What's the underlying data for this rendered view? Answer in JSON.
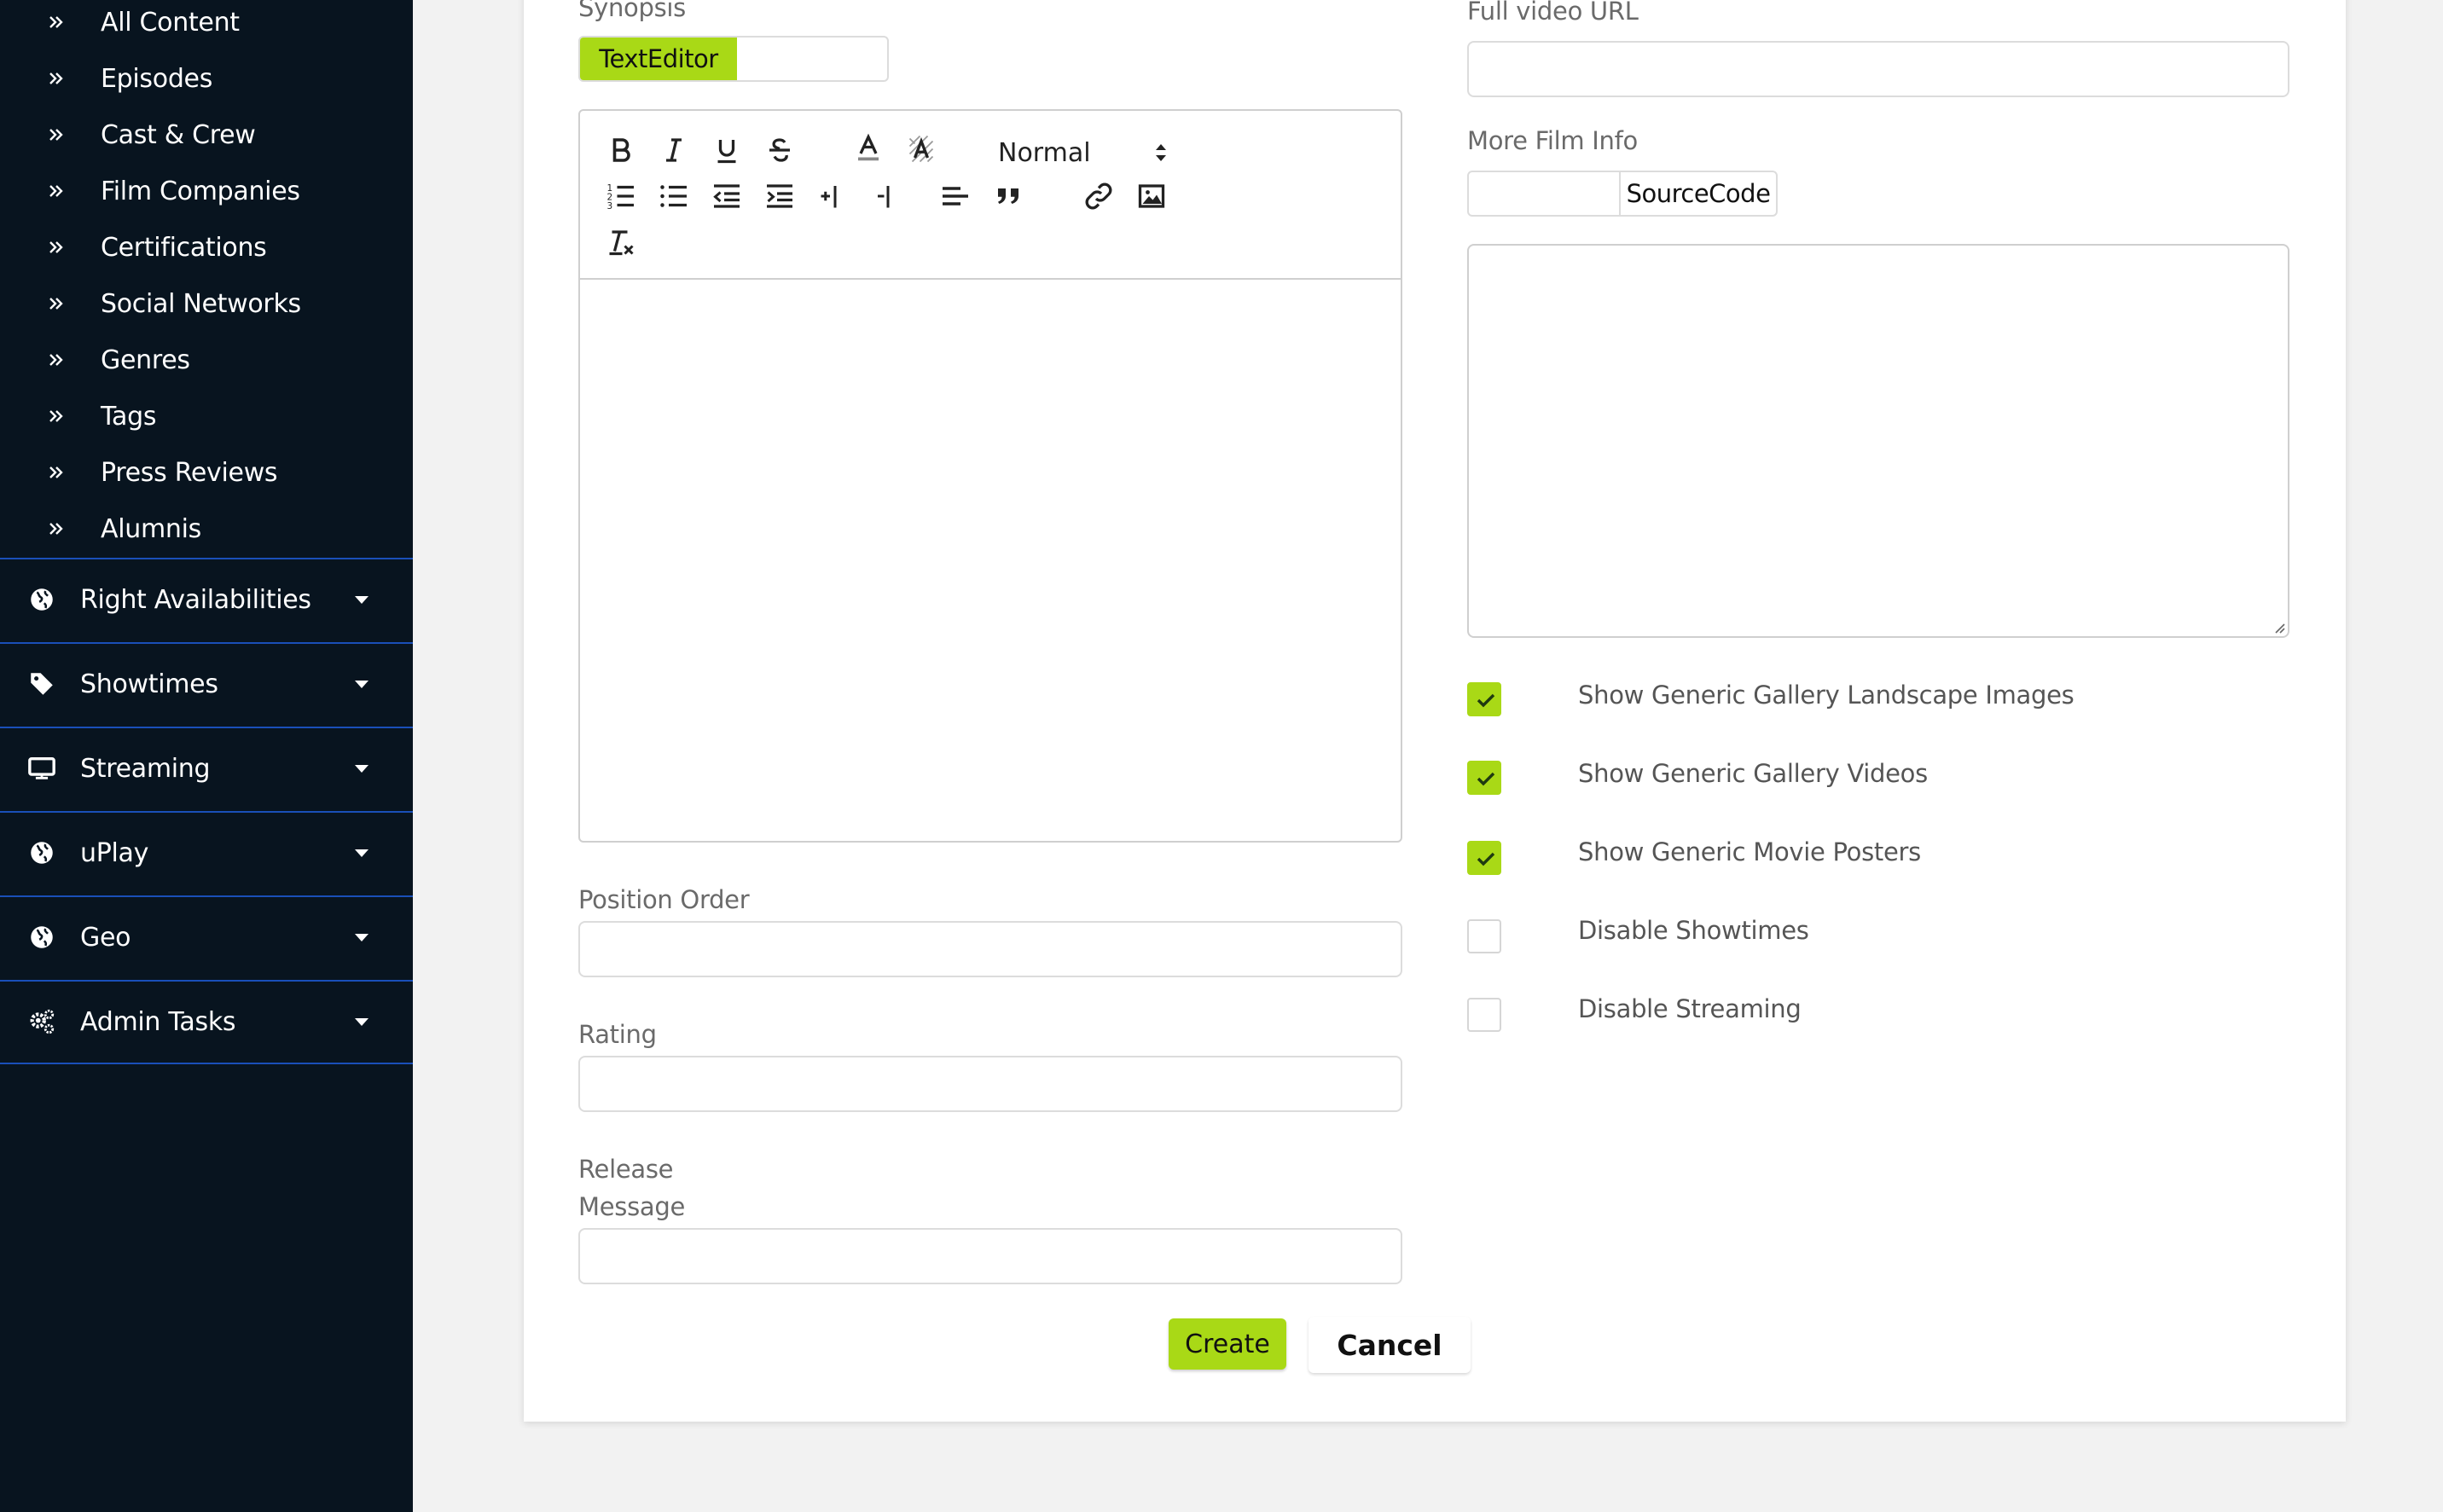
{
  "sidebar": {
    "sub_items": [
      {
        "label": "All Content"
      },
      {
        "label": "Episodes"
      },
      {
        "label": "Cast & Crew"
      },
      {
        "label": "Film Companies"
      },
      {
        "label": "Certifications"
      },
      {
        "label": "Social Networks"
      },
      {
        "label": "Genres"
      },
      {
        "label": "Tags"
      },
      {
        "label": "Press Reviews"
      },
      {
        "label": "Alumnis"
      }
    ],
    "menu_items": [
      {
        "label": "Right Availabilities",
        "icon": "globe-icon"
      },
      {
        "label": "Showtimes",
        "icon": "tag-icon"
      },
      {
        "label": "Streaming",
        "icon": "monitor-icon"
      },
      {
        "label": "uPlay",
        "icon": "globe-icon"
      },
      {
        "label": "Geo",
        "icon": "globe-icon"
      },
      {
        "label": "Admin Tasks",
        "icon": "gears-icon"
      }
    ]
  },
  "form": {
    "synopsis": {
      "label": "Synopsis",
      "mode_text_editor": "TextEditor",
      "mode_source_code": "",
      "format_select": "Normal",
      "body": ""
    },
    "position_order": {
      "label": "Position Order",
      "value": ""
    },
    "rating": {
      "label": "Rating",
      "value": ""
    },
    "release_message": {
      "label_line1": "Release",
      "label_line2": "Message",
      "value": ""
    },
    "full_video_url": {
      "label": "Full video URL",
      "value": ""
    },
    "more_film_info": {
      "label": "More Film Info",
      "mode_text_editor": "",
      "mode_source_code": "SourceCode",
      "value": ""
    },
    "checkboxes": [
      {
        "label": "Show Generic Gallery Landscape Images",
        "checked": true
      },
      {
        "label": "Show Generic Gallery Videos",
        "checked": true
      },
      {
        "label": "Show Generic Movie Posters",
        "checked": true
      },
      {
        "label": "Disable Showtimes",
        "checked": false
      },
      {
        "label": "Disable Streaming",
        "checked": false
      }
    ],
    "actions": {
      "create": "Create",
      "cancel": "Cancel"
    }
  },
  "colors": {
    "sidebar_bg": "#08141f",
    "sidebar_divider": "#1a4fb8",
    "accent": "#a9d916",
    "page_bg": "#f2f2f2"
  }
}
